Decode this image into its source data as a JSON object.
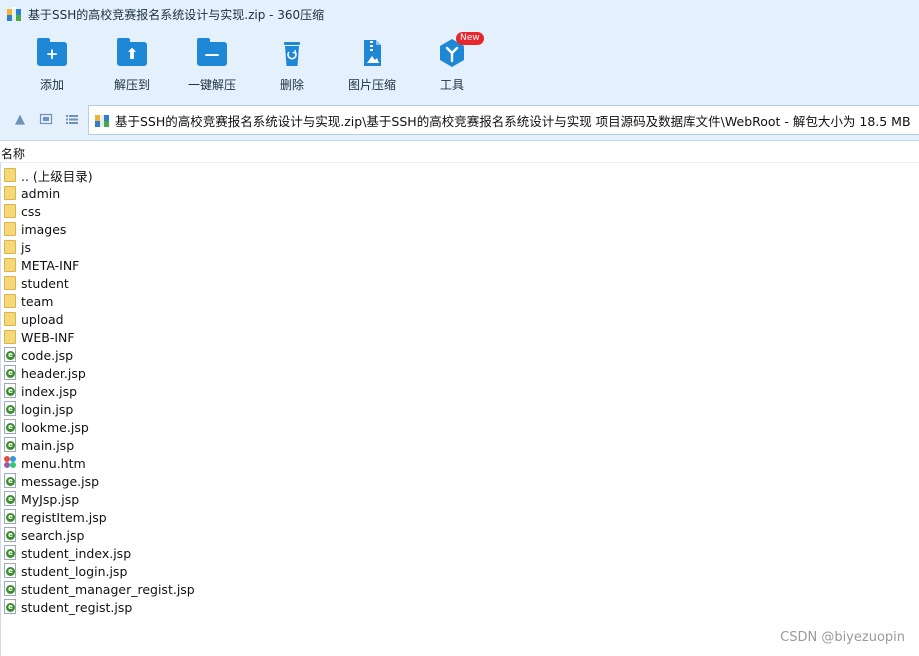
{
  "window": {
    "title": "基于SSH的高校竞赛报名系统设计与实现.zip - 360压缩"
  },
  "toolbar": {
    "buttons": [
      {
        "label": "添加",
        "icon": "add-icon"
      },
      {
        "label": "解压到",
        "icon": "extract-to-icon"
      },
      {
        "label": "一键解压",
        "icon": "one-click-extract-icon"
      },
      {
        "label": "删除",
        "icon": "delete-icon"
      },
      {
        "label": "图片压缩",
        "icon": "image-compress-icon"
      },
      {
        "label": "工具",
        "icon": "tools-icon",
        "badge": "New"
      }
    ]
  },
  "addressbar": {
    "path": "基于SSH的高校竞赛报名系统设计与实现.zip\\基于SSH的高校竞赛报名系统设计与实现 项目源码及数据库文件\\WebRoot - 解包大小为 18.5 MB"
  },
  "list": {
    "column_name": "名称",
    "items": [
      {
        "name": ".. (上级目录)",
        "type": "folder"
      },
      {
        "name": "admin",
        "type": "folder"
      },
      {
        "name": "css",
        "type": "folder"
      },
      {
        "name": "images",
        "type": "folder"
      },
      {
        "name": "js",
        "type": "folder"
      },
      {
        "name": "META-INF",
        "type": "folder"
      },
      {
        "name": "student",
        "type": "folder"
      },
      {
        "name": "team",
        "type": "folder"
      },
      {
        "name": "upload",
        "type": "folder"
      },
      {
        "name": "WEB-INF",
        "type": "folder"
      },
      {
        "name": "code.jsp",
        "type": "jsp"
      },
      {
        "name": "header.jsp",
        "type": "jsp"
      },
      {
        "name": "index.jsp",
        "type": "jsp"
      },
      {
        "name": "login.jsp",
        "type": "jsp"
      },
      {
        "name": "lookme.jsp",
        "type": "jsp"
      },
      {
        "name": "main.jsp",
        "type": "jsp"
      },
      {
        "name": "menu.htm",
        "type": "htm"
      },
      {
        "name": "message.jsp",
        "type": "jsp"
      },
      {
        "name": "MyJsp.jsp",
        "type": "jsp"
      },
      {
        "name": "registItem.jsp",
        "type": "jsp"
      },
      {
        "name": "search.jsp",
        "type": "jsp"
      },
      {
        "name": "student_index.jsp",
        "type": "jsp"
      },
      {
        "name": "student_login.jsp",
        "type": "jsp"
      },
      {
        "name": "student_manager_regist.jsp",
        "type": "jsp"
      },
      {
        "name": "student_regist.jsp",
        "type": "jsp"
      }
    ]
  },
  "watermark": "CSDN @biyezuopin",
  "colors": {
    "accent": "#1e88d6",
    "chrome": "#e4f0fb",
    "folder": "#f7d879"
  }
}
